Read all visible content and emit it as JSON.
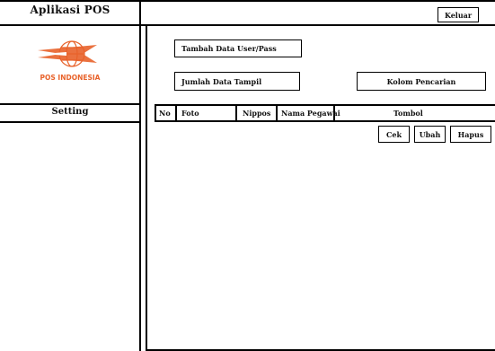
{
  "app": {
    "title": "Aplikasi POS",
    "logo_text": "POS INDONESIA",
    "logo_color": "#e8622a"
  },
  "header": {
    "logout_label": "Keluar"
  },
  "sidebar": {
    "setting_label": "Setting"
  },
  "main": {
    "add_user_label": "Tambah Data User/Pass",
    "display_count_label": "Jumlah Data Tampil",
    "search_label": "Kolom Pencarian"
  },
  "table": {
    "headers": [
      "No",
      "Foto",
      "Nippos",
      "Nama Pegawai",
      "Tombol"
    ],
    "actions": {
      "check": "Cek",
      "edit": "Ubah",
      "delete": "Hapus"
    }
  }
}
